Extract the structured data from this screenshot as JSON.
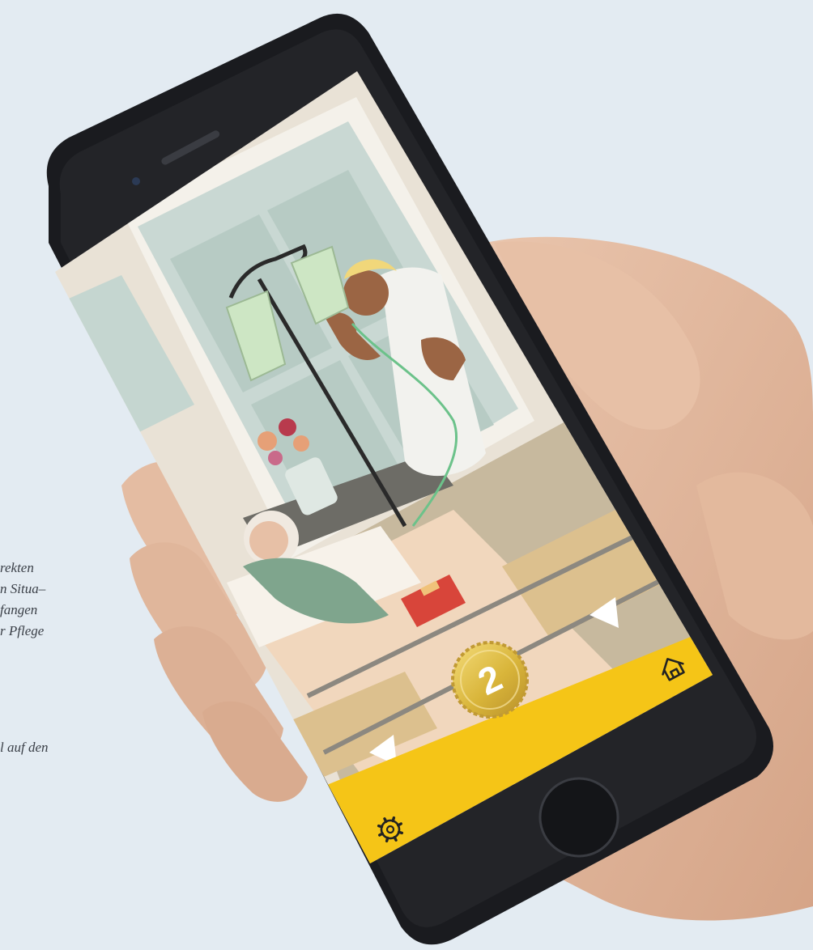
{
  "captions": {
    "block1": [
      "rekten",
      "n Situa–",
      "fangen",
      "r Pflege"
    ],
    "block2": [
      "l auf den"
    ]
  },
  "game": {
    "level_badge": "2",
    "icons": {
      "home": "home-icon",
      "settings": "gear-icon"
    }
  },
  "colors": {
    "background": "#e3ebf2",
    "bottom_bar": "#f5c517",
    "coin_gold": "#d9b53a",
    "scrub_white": "#f2f2ee",
    "patient_sweater": "#7fa58d",
    "book_red": "#d8453a",
    "iv_fluid": "#cde6c4"
  }
}
